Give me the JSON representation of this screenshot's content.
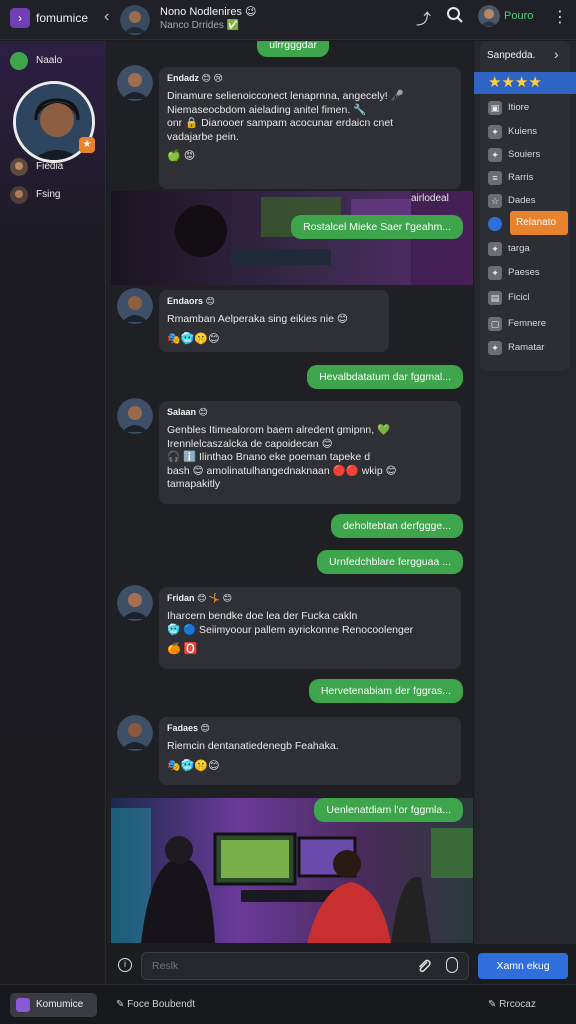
{
  "app": {
    "name": "fomumice"
  },
  "header": {
    "chat_title": "Nono Nodlenires 😉",
    "chat_subtitle": "Nanco Drrides ✅",
    "user_name": "Pouro"
  },
  "sidebar": {
    "items": [
      {
        "label": "Naalo",
        "icon": "chat-icon"
      },
      {
        "label": "Fiedia",
        "icon": "avatar-icon"
      },
      {
        "label": "Fsing",
        "icon": "avatar-icon"
      }
    ]
  },
  "messages": {
    "top_out": "ulrrgggdar",
    "m1": {
      "sender": "Endadz 😊 😢",
      "text": "Dinamure selienoicconect lenaprnna, angecely! 🎤\nNiemaseocbdom aielading anitel fimen. 🔧\nonr 🔒 Dianooer sampam acocunar erdaicn cnet\nvadajarbe pein.",
      "reactions": "🍏 😡"
    },
    "photo1_caption": "airlodeal",
    "m1_out": "Rostalcel Mieke Saer f'geahm...",
    "m2": {
      "sender": "Endaors 😊",
      "text": "Rmamban Aelperaka sing eikies nie 😊",
      "reactions": "🎭🥶🤫😊"
    },
    "m2_out": "Hevalbdatatum dar fggmal...",
    "m3": {
      "sender": "Salaan 😊",
      "text": "Genbles Itimealorom baem alredent gmipnn, 💚\nIrennlelcaszalcka de capoidecan 😊\n🎧 ℹ️ Ilinthao Bnano eke poeman tapeke d\nbash 😊 amolinatulhangednaknaan 🔴🔴 wkip 😊\ntamapakitly",
      "reactions": ""
    },
    "m3_out1": "deholtebtan derfggge...",
    "m3_out2": "Urnfedchblare fergguaa ...",
    "m4": {
      "sender": "Fridan 😊 🤸 😊",
      "text": "Iharcern bendke doe lea der Fucka cakln\n🥶 🔵 Seiimyoour pallem ayrickonne Renocoolenger",
      "reactions": "🍊 🅾️"
    },
    "m4_out": "Hervetenabiam der fggras...",
    "m5": {
      "sender": "Fadaes 😊",
      "text": "Riemcin dentanatiedenegb Feahaka.",
      "reactions": "🎭🥶🤫😊"
    },
    "m5_out": "Uenlenatdiam l'or fggmla..."
  },
  "right_panel": {
    "header": "Sanpedda.",
    "stars": "★★★★",
    "items": [
      {
        "label": "Itiore",
        "icon": "lock-icon"
      },
      {
        "label": "Kuiens",
        "icon": "gear-icon"
      },
      {
        "label": "Souiers",
        "icon": "gear-icon"
      },
      {
        "label": "Rarris",
        "icon": "list-icon"
      },
      {
        "label": "Dades",
        "icon": "star-icon"
      },
      {
        "label": "Relanato",
        "icon": "bell-icon"
      },
      {
        "label": "targa",
        "icon": "gear-icon"
      },
      {
        "label": "Paeses",
        "icon": "gear-icon"
      },
      {
        "label": "Ficicl",
        "icon": "doc-icon"
      },
      {
        "label": "Femnere",
        "icon": "image-icon"
      },
      {
        "label": "Ramatar",
        "icon": "gear-icon"
      }
    ]
  },
  "composer": {
    "placeholder": "Reslk",
    "send_label": "Xamn ekug"
  },
  "bottombar": {
    "pill_label": "Komumice",
    "link1": "Foce Boubendt",
    "link2": "Rrcocaz"
  },
  "colors": {
    "accent_green": "#3fa54d",
    "accent_blue": "#2f6fdb",
    "accent_orange": "#e9822c"
  }
}
